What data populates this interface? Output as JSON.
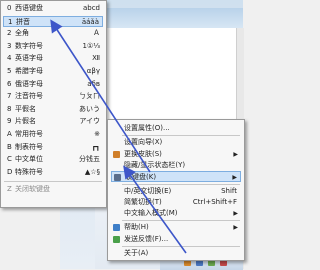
{
  "keyboard_menu": {
    "items": [
      {
        "num": "0",
        "label": "西语键盘",
        "value": "abcd",
        "selected": false,
        "disabled": false
      },
      {
        "num": "1",
        "label": "拼音",
        "value": "āáǎà",
        "selected": true,
        "disabled": false
      },
      {
        "num": "2",
        "label": "全角",
        "value": "Ａ",
        "selected": false,
        "disabled": false
      },
      {
        "num": "3",
        "label": "数字符号",
        "value": "1①⅓",
        "selected": false,
        "disabled": false
      },
      {
        "num": "4",
        "label": "英语字母",
        "value": "Ⅻ",
        "selected": false,
        "disabled": false
      },
      {
        "num": "5",
        "label": "希腊字母",
        "value": "αβγ",
        "selected": false,
        "disabled": false
      },
      {
        "num": "6",
        "label": "俄语字母",
        "value": "абв",
        "selected": false,
        "disabled": false
      },
      {
        "num": "7",
        "label": "注音符号",
        "value": "ㄅㄆㄇ",
        "selected": false,
        "disabled": false
      },
      {
        "num": "8",
        "label": "平假名",
        "value": "あいう",
        "selected": false,
        "disabled": false
      },
      {
        "num": "9",
        "label": "片假名",
        "value": "アイウ",
        "selected": false,
        "disabled": false
      },
      {
        "num": "A",
        "label": "常用符号",
        "value": "※",
        "selected": false,
        "disabled": false
      },
      {
        "num": "B",
        "label": "制表符号",
        "value": "┏┓",
        "selected": false,
        "disabled": false
      },
      {
        "num": "C",
        "label": "中文单位",
        "value": "分钱五",
        "selected": false,
        "disabled": false
      },
      {
        "num": "D",
        "label": "特殊符号",
        "value": "▲☆§",
        "selected": false,
        "disabled": false
      },
      {
        "num": "Z",
        "label": "关闭软键盘",
        "value": "",
        "selected": false,
        "disabled": true
      }
    ]
  },
  "context_menu": {
    "items": [
      {
        "label": "设置属性(O)...",
        "shortcut": "",
        "submenu": false,
        "highlighted": false
      },
      {
        "label": "设置向导(X)",
        "shortcut": "",
        "submenu": false,
        "highlighted": false
      },
      {
        "label": "更换皮肤(S)",
        "shortcut": "",
        "submenu": true,
        "highlighted": false
      },
      {
        "label": "隐藏/显示状态栏(Y)",
        "shortcut": "",
        "submenu": false,
        "highlighted": false
      },
      {
        "label": "软键盘(K)",
        "shortcut": "",
        "submenu": true,
        "highlighted": true
      },
      {
        "label": "中/英文切换(E)",
        "shortcut": "Shift",
        "submenu": false,
        "highlighted": false
      },
      {
        "label": "简繁切换(T)",
        "shortcut": "Ctrl+Shift+F",
        "submenu": false,
        "highlighted": false
      },
      {
        "label": "中文输入模式(M)",
        "shortcut": "",
        "submenu": true,
        "highlighted": false
      },
      {
        "label": "帮助(H)",
        "shortcut": "",
        "submenu": true,
        "highlighted": false
      },
      {
        "label": "发送反馈(F)...",
        "shortcut": "",
        "submenu": false,
        "highlighted": false
      },
      {
        "label": "关于(A)",
        "shortcut": "",
        "submenu": false,
        "highlighted": false
      }
    ]
  },
  "colors": {
    "highlight_bg": "#cfe3f8",
    "highlight_border": "#7eaee0",
    "arrow": "#3d56c9"
  },
  "icons": [
    "submenu-arrow-icon",
    "skin-icon",
    "keyboard-icon",
    "help-icon",
    "feedback-icon"
  ]
}
